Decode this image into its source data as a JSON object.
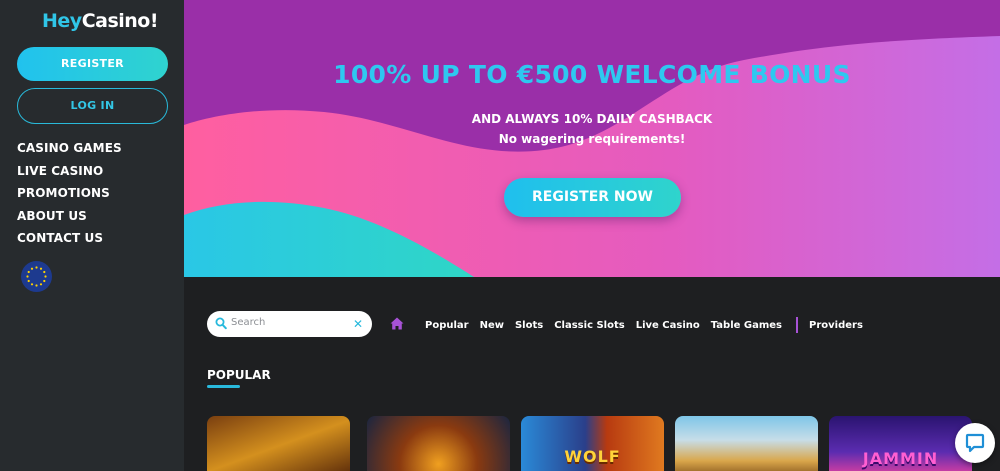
{
  "brand": {
    "logo_hey": "Hey",
    "logo_casino": "Casino!"
  },
  "sidebar": {
    "register_label": "REGISTER",
    "login_label": "LOG IN",
    "nav": [
      "CASINO GAMES",
      "LIVE CASINO",
      "PROMOTIONS",
      "ABOUT US",
      "CONTACT US"
    ],
    "language_icon": "eu-flag-icon"
  },
  "hero": {
    "title": "100% UP TO €500 WELCOME BONUS",
    "subtitle": "AND ALWAYS 10% DAILY CASHBACK",
    "subtitle2": "No wagering requirements!",
    "cta_label": "REGISTER NOW"
  },
  "search": {
    "placeholder": "Search"
  },
  "categories": [
    "Popular",
    "New",
    "Slots",
    "Classic Slots",
    "Live Casino",
    "Table Games"
  ],
  "providers_label": "Providers",
  "section": {
    "popular_title": "POPULAR"
  },
  "games": [
    {
      "label": ""
    },
    {
      "label": ""
    },
    {
      "label": "WOLF"
    },
    {
      "label": ""
    },
    {
      "label": "JAMMIN"
    }
  ],
  "colors": {
    "accent_cyan": "#2ec8f0",
    "accent_purple": "#a752d6",
    "hero_purple": "#9a2fa8",
    "hero_pink": "#f056a8",
    "sidebar_bg": "#272b2e",
    "page_bg": "#1e1f21"
  }
}
